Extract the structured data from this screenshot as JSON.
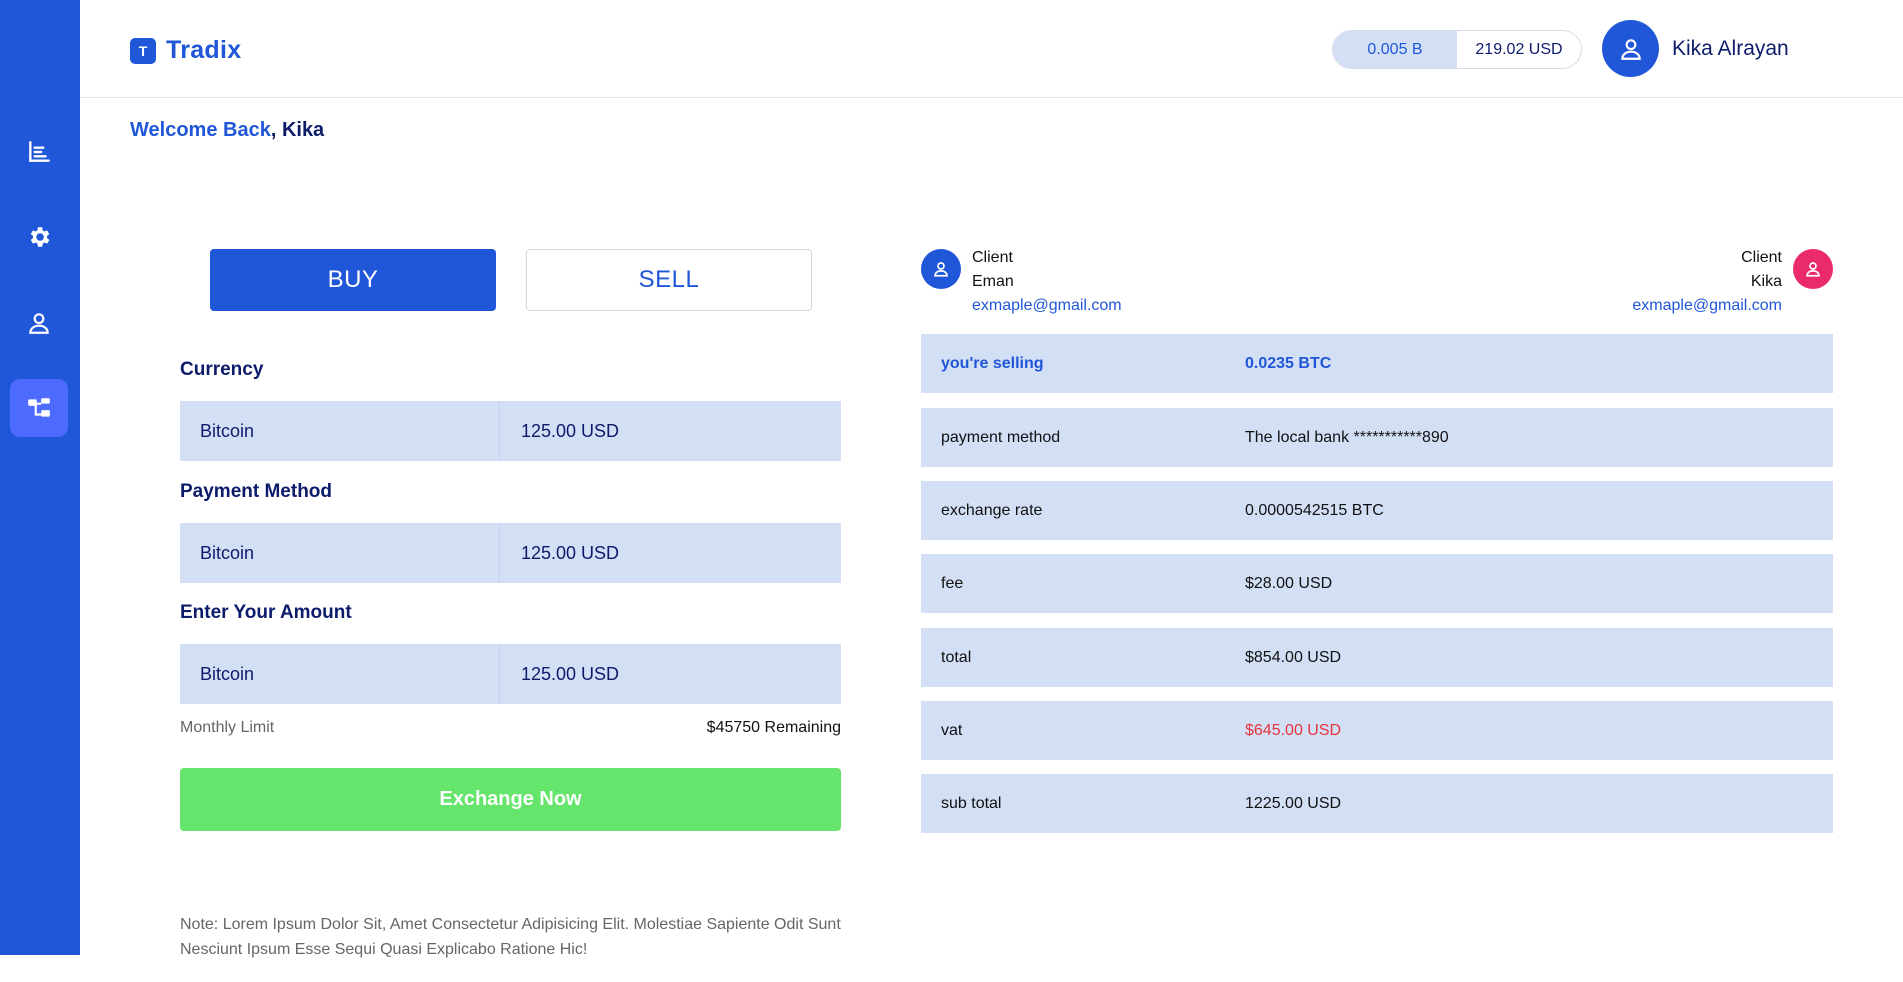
{
  "app": {
    "name": "Tradix",
    "logo_letter": "T"
  },
  "header": {
    "balance_btc": "0.005 B",
    "balance_usd": "219.02 USD",
    "user_name": "Kika Alrayan"
  },
  "sidebar": {
    "items": [
      {
        "icon": "bar-chart-icon",
        "active": false
      },
      {
        "icon": "gear-icon",
        "active": false
      },
      {
        "icon": "user-icon",
        "active": false
      },
      {
        "icon": "network-icon",
        "active": true
      }
    ]
  },
  "welcome": {
    "greeting": "Welcome Back",
    "separator": ", ",
    "name": "Kika"
  },
  "trade": {
    "buy_label": "BUY",
    "sell_label": "SELL",
    "currency_label": "Currency",
    "currency": {
      "asset": "Bitcoin",
      "amount": "125.00 USD"
    },
    "payment_label": "Payment Method",
    "payment": {
      "asset": "Bitcoin",
      "amount": "125.00 USD"
    },
    "amount_label": "Enter Your Amount",
    "amount": {
      "asset": "Bitcoin",
      "amount": "125.00 USD"
    },
    "limit_label": "Monthly Limit",
    "limit_value": "$45750 Remaining",
    "exchange_button": "Exchange Now",
    "note": "Note: Lorem Ipsum Dolor Sit, Amet Consectetur Adipisicing Elit. Molestiae Sapiente Odit Sunt Nesciunt Ipsum Esse Sequi Quasi Explicabo Ratione Hic!"
  },
  "clients": {
    "left": {
      "role": "Client",
      "name": "Eman",
      "email": "exmaple@gmail.com"
    },
    "right": {
      "role": "Client",
      "name": "Kika",
      "email": "exmaple@gmail.com"
    }
  },
  "details": {
    "selling": {
      "label": "you're selling",
      "value": "0.0235 BTC"
    },
    "payment_method": {
      "label": "payment method",
      "value": "The local bank ***********890"
    },
    "exchange_rate": {
      "label": "exchange rate",
      "value": "0.0000542515 BTC"
    },
    "fee": {
      "label": "fee",
      "value": "$28.00 USD"
    },
    "total": {
      "label": "total",
      "value": "$854.00 USD"
    },
    "vat": {
      "label": "vat",
      "value": "$645.00 USD"
    },
    "sub_total": {
      "label": "sub total",
      "value": "1225.00 USD"
    }
  },
  "colors": {
    "primary": "#2057d9",
    "sidebar_active": "#4d6bff",
    "row_bg": "#d3dff5",
    "exchange_green": "#66e56c",
    "vat_red": "#e8343a",
    "client_pink": "#eb2a6c",
    "navy_text": "#0d1b6b"
  }
}
